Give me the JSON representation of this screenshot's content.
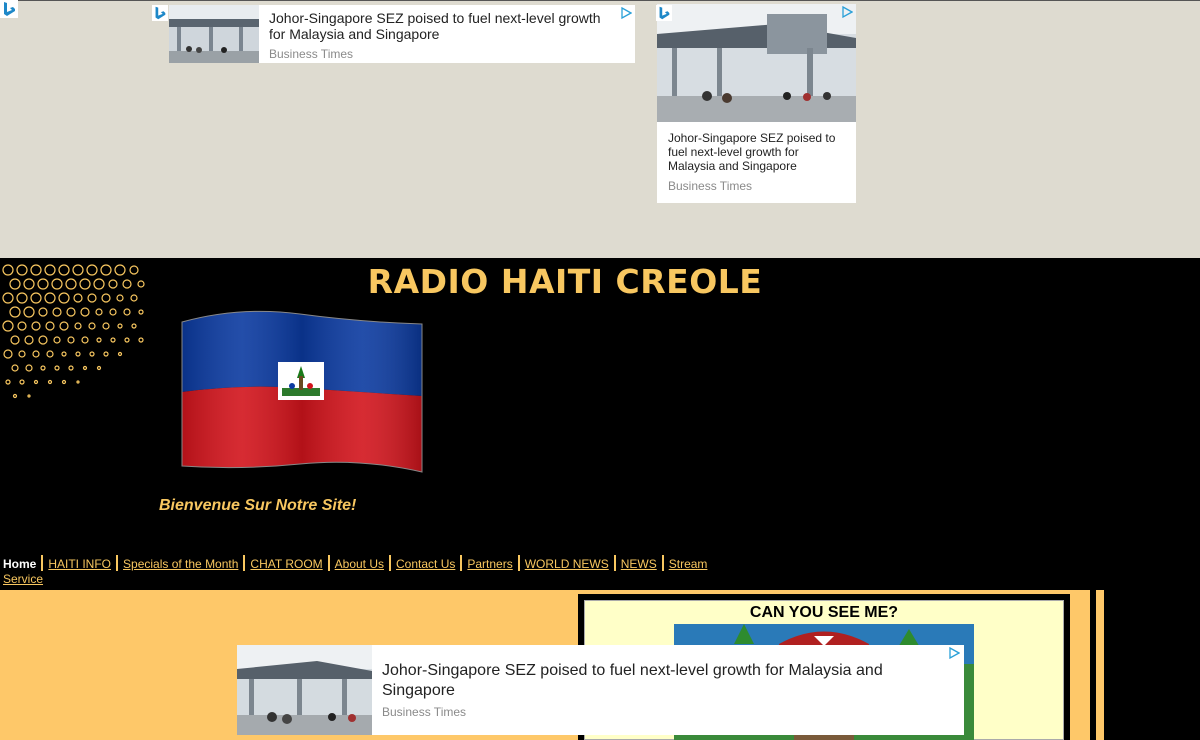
{
  "ads": {
    "top_left": {
      "title": "Johor-Singapore SEZ poised to fuel next-level growth for Malaysia and Singapore",
      "source": "Business Times"
    },
    "top_right": {
      "title": "Johor-Singapore SEZ poised to fuel next-level growth for Malaysia and Singapore",
      "source": "Business Times"
    },
    "bottom": {
      "title": "Johor-Singapore SEZ poised to fuel next-level growth for Malaysia and Singapore",
      "source": "Business Times"
    }
  },
  "site": {
    "title": "RADIO HAITI CREOLE",
    "welcome": "Bienvenue Sur Notre Site!"
  },
  "nav": {
    "items": [
      "Home",
      "HAITI INFO",
      "Specials of the Month",
      "CHAT ROOM",
      "About Us",
      "Contact Us",
      "Partners",
      "WORLD NEWS",
      "NEWS",
      "Stream Service"
    ]
  },
  "sidebar": {
    "title": "CAN YOU SEE ME?"
  },
  "colors": {
    "accent": "#f8c760",
    "content_bg": "#fec869",
    "top_band": "#dedbd0",
    "flag_blue": "#0b3aa0",
    "flag_red": "#d2141c"
  },
  "icons": [
    "bing-logo-icon",
    "adchoices-icon"
  ]
}
